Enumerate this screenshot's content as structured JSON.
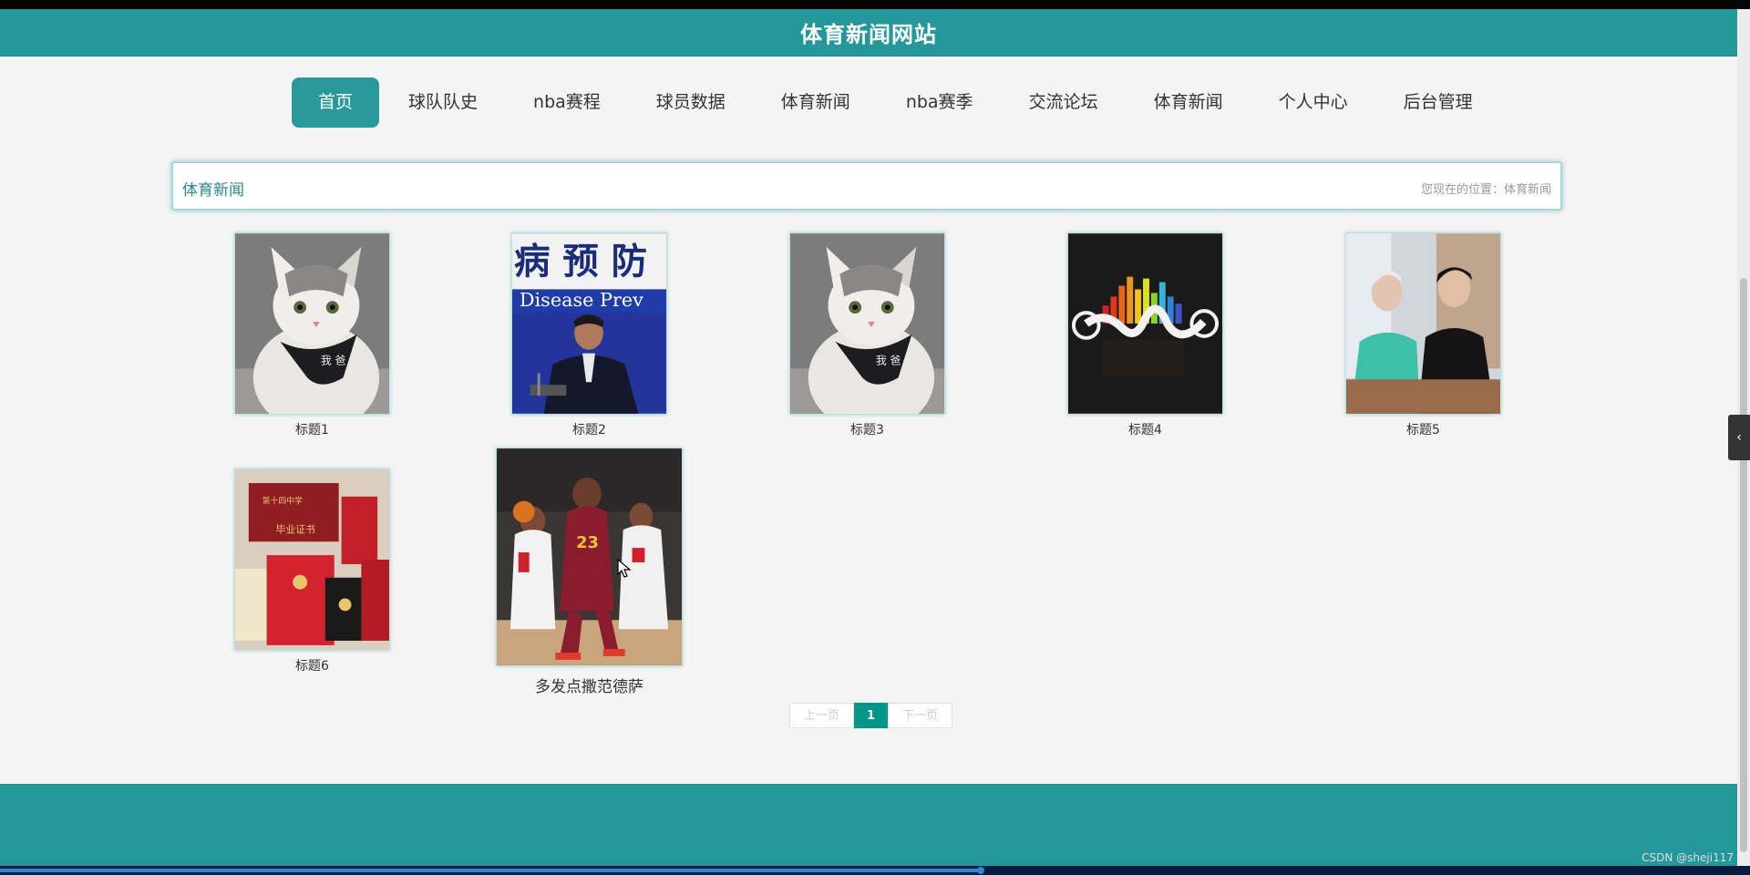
{
  "site": {
    "title": "体育新闻网站"
  },
  "nav": {
    "items": [
      {
        "label": "首页",
        "active": true
      },
      {
        "label": "球队队史"
      },
      {
        "label": "nba赛程"
      },
      {
        "label": "球员数据"
      },
      {
        "label": "体育新闻"
      },
      {
        "label": "nba赛季"
      },
      {
        "label": "交流论坛"
      },
      {
        "label": "体育新闻"
      },
      {
        "label": "个人中心"
      },
      {
        "label": "后台管理"
      }
    ]
  },
  "section": {
    "title": "体育新闻",
    "breadcrumb": "您现在的位置：体育新闻"
  },
  "cards": [
    {
      "title": "标题1",
      "image": "cat-bandana"
    },
    {
      "title": "标题2",
      "image": "press-conference",
      "image_text": "病 预 防 Disease Prev"
    },
    {
      "title": "标题3",
      "image": "cat-bandana"
    },
    {
      "title": "标题4",
      "image": "sound-equalizer"
    },
    {
      "title": "标题5",
      "image": "two-people-portrait"
    },
    {
      "title": "标题6",
      "image": "certificates"
    },
    {
      "title": "多发点撒范德萨",
      "image": "basketball-game"
    }
  ],
  "pager": {
    "prev": "上一页",
    "current": "1",
    "next": "下一页"
  },
  "icons": {
    "side_toggle": "chevron-left-icon"
  },
  "watermark": "CSDN @sheji117",
  "colors": {
    "primary": "#24979a",
    "active_page": "#009688"
  }
}
